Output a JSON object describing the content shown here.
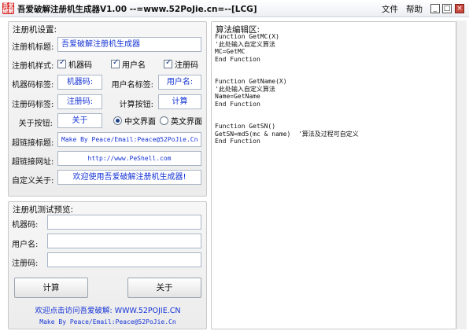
{
  "window": {
    "logo_text": "吾爱\n破解",
    "title": "吾爱破解注册机生成器V1.00  --=www.52PoJie.cn=--[LCG]",
    "menu": [
      "文件",
      "帮助"
    ],
    "controls": [
      "_",
      "□",
      "×"
    ]
  },
  "settings": {
    "title": "注册机设置:",
    "title_label": "注册机标题:",
    "title_value": "吾爱破解注册机生成器",
    "style_label": "注册机样式:",
    "style_checks": [
      "机器码",
      "用户名",
      "注册码"
    ],
    "machine_label": "机器码标签:",
    "machine_value": "机器码:",
    "user_label": "用户名标签:",
    "user_value": "用户名:",
    "regcode_label": "注册码标签:",
    "regcode_value": "注册码:",
    "calc_label": "计算按钮:",
    "calc_value": "计算",
    "about_label": "关于按钮:",
    "about_value": "关于",
    "radio_cn": "中文界面",
    "radio_en": "英文界面",
    "link_title_label": "超链接标题:",
    "link_title_value": "Make By Peace/Email:Peace@52PoJie.Cn",
    "link_url_label": "超链接网址:",
    "link_url_value": "http://www.PeShell.com",
    "custom_about_label": "自定义关于:",
    "custom_about_value": "欢迎使用吾爱破解注册机生成器!"
  },
  "preview": {
    "title": "注册机测试预览:",
    "machine_label": "机器码:",
    "user_label": "用户名:",
    "regcode_label": "注册码:",
    "calc_button": "计算",
    "about_button": "关于",
    "visit_text": "欢迎点击访问吾爱破解: WWW.52POJIE.CN",
    "make_text": "Make By Peace/Email:Peace@52PoJie.Cn"
  },
  "editor": {
    "title": "算法编辑区:",
    "code": "Function GetMC(X)\n'此处输入自定义算法\nMC=GetMC\nEnd Function\n\n\nFunction GetName(X)\n'此处输入自定义算法\nName=GetName\nEnd Function\n\n\nFunction GetSN()\nGetSN=md5(mc & name)  '算法及过程可自定义\nEnd Function"
  }
}
